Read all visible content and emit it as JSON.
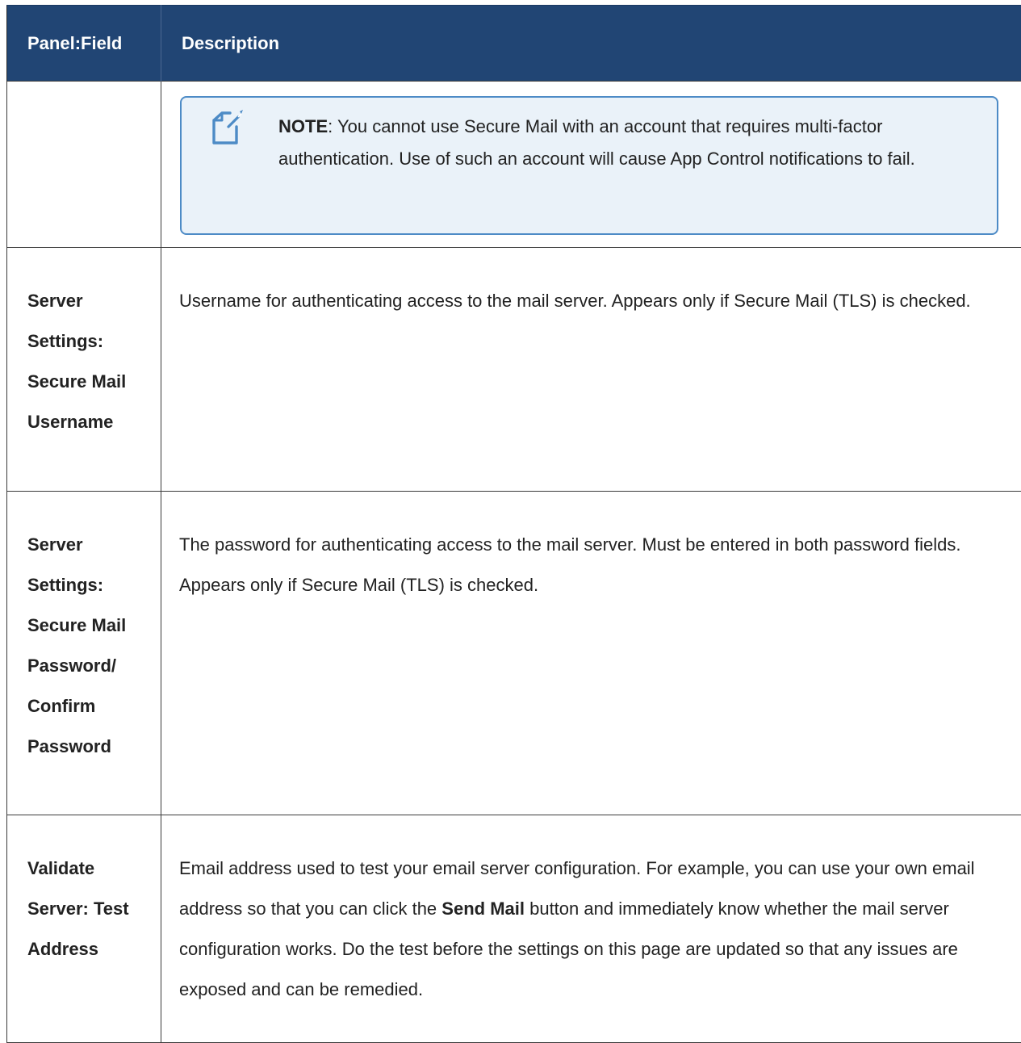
{
  "table": {
    "headers": {
      "field": "Panel:Field",
      "description": "Description"
    },
    "note": {
      "label": "NOTE",
      "text": ": You cannot use Secure Mail with an account that requires multi-factor authentication. Use of such an account will cause App Control notifications to fail."
    },
    "rows": [
      {
        "field": "Server Settings: Secure Mail Username",
        "description": "Username for authenticating access to the mail server. Appears only if Secure Mail (TLS) is checked."
      },
      {
        "field": "Server Settings: Secure Mail Password/ Confirm Password",
        "description": "The password for authenticating access to the mail server. Must be entered in both password fields. Appears only if Secure Mail (TLS) is checked."
      },
      {
        "field": "Validate Server: Test Address",
        "description_before": "Email address used to test your email server configuration. For example, you can use your own email address so that you can click the ",
        "description_bold": "Send Mail",
        "description_after": " button and immediately know whether the mail server configuration works. Do the test before the settings on this page are updated so that any issues are exposed and can be remedied."
      }
    ]
  },
  "icons": {
    "note_icon": "edit-note-icon"
  },
  "colors": {
    "header_background": "#214574",
    "note_border": "#4d8bc6",
    "note_background": "#eaf2f9"
  }
}
